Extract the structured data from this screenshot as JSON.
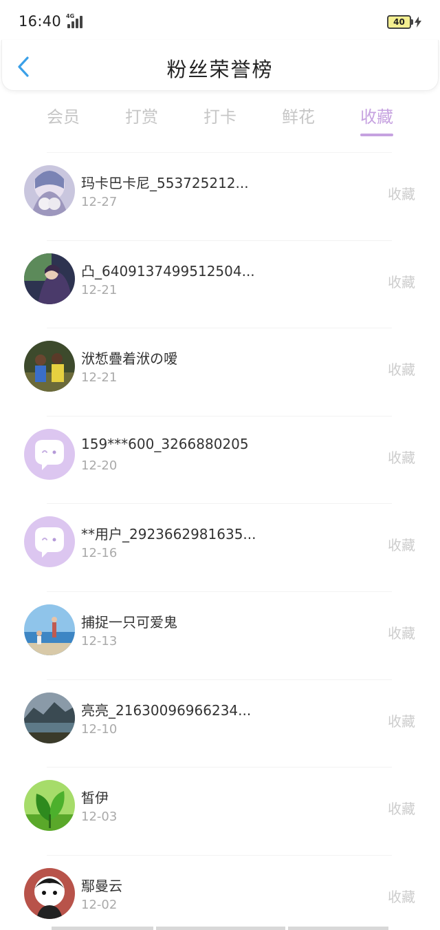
{
  "status_bar": {
    "time": "16:40",
    "network": "4G",
    "battery": "40"
  },
  "header": {
    "title": "粉丝荣誉榜"
  },
  "colors": {
    "accent": "#c6a2e0",
    "inactive_tab": "#c6c6c6",
    "action": "#cccccc"
  },
  "tabs": [
    {
      "label": "会员",
      "active": false
    },
    {
      "label": "打赏",
      "active": false
    },
    {
      "label": "打卡",
      "active": false
    },
    {
      "label": "鲜花",
      "active": false
    },
    {
      "label": "收藏",
      "active": true
    }
  ],
  "fans": [
    {
      "name": "玛卡巴卡尼_553725212...",
      "date": "12-27",
      "action": "收藏",
      "avatar": "anime-girl-avatar"
    },
    {
      "name": "凸_6409137499512504...",
      "date": "12-21",
      "action": "收藏",
      "avatar": "anime-character-avatar"
    },
    {
      "name": "洑惁疊着洑の嗳",
      "date": "12-21",
      "action": "收藏",
      "avatar": "children-photo-avatar"
    },
    {
      "name": "159***600_3266880205",
      "date": "12-20",
      "action": "收藏",
      "avatar": "default-chat-avatar"
    },
    {
      "name": "**用户_2923662981635...",
      "date": "12-16",
      "action": "收藏",
      "avatar": "default-chat-avatar"
    },
    {
      "name": "捕捉一只可爱鬼",
      "date": "12-13",
      "action": "收藏",
      "avatar": "beach-photo-avatar"
    },
    {
      "name": "亮亮_21630096966234...",
      "date": "12-10",
      "action": "收藏",
      "avatar": "mountain-lake-avatar"
    },
    {
      "name": "皙伊",
      "date": "12-03",
      "action": "收藏",
      "avatar": "green-leaf-avatar"
    },
    {
      "name": "鄢曼云",
      "date": "12-02",
      "action": "收藏",
      "avatar": "panda-doll-avatar"
    }
  ]
}
